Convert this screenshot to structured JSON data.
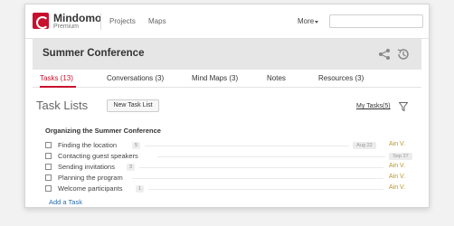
{
  "app": {
    "brand": "Mindomo",
    "edition": "Premium",
    "nav": [
      {
        "label": "Projects"
      },
      {
        "label": "Maps"
      }
    ],
    "more_label": "More",
    "search": {
      "value": "",
      "placeholder": ""
    },
    "colors": {
      "accent": "#c8102e",
      "assignee": "#b5962a",
      "link": "#2b6cb0"
    }
  },
  "project": {
    "title": "Summer Conference",
    "tabs": [
      {
        "label": "Tasks (13)",
        "active": true
      },
      {
        "label": "Conversations (3)",
        "active": false
      },
      {
        "label": "Mind Maps (3)",
        "active": false
      },
      {
        "label": "Notes",
        "active": false
      },
      {
        "label": "Resources (3)",
        "active": false
      }
    ]
  },
  "tasks_panel": {
    "heading": "Task Lists",
    "new_task_list_label": "New Task List",
    "my_tasks_label": "My Tasks(5)",
    "group": {
      "title": "Organizing the Summer Conference",
      "tasks": [
        {
          "name": "Finding the location",
          "count": "5",
          "date": "Aug 22",
          "assignee": "Ain V."
        },
        {
          "name": "Contacting guest speakers",
          "count": "",
          "date": "Sep 27",
          "assignee": ""
        },
        {
          "name": "Sending invitations",
          "count": "3",
          "date": "",
          "assignee": "Ain V."
        },
        {
          "name": "Planning the program",
          "count": "",
          "date": "",
          "assignee": "Ain V."
        },
        {
          "name": "Welcome participants",
          "count": "1",
          "date": "",
          "assignee": "Ain V."
        }
      ],
      "add_task_label": "Add a Task"
    }
  }
}
